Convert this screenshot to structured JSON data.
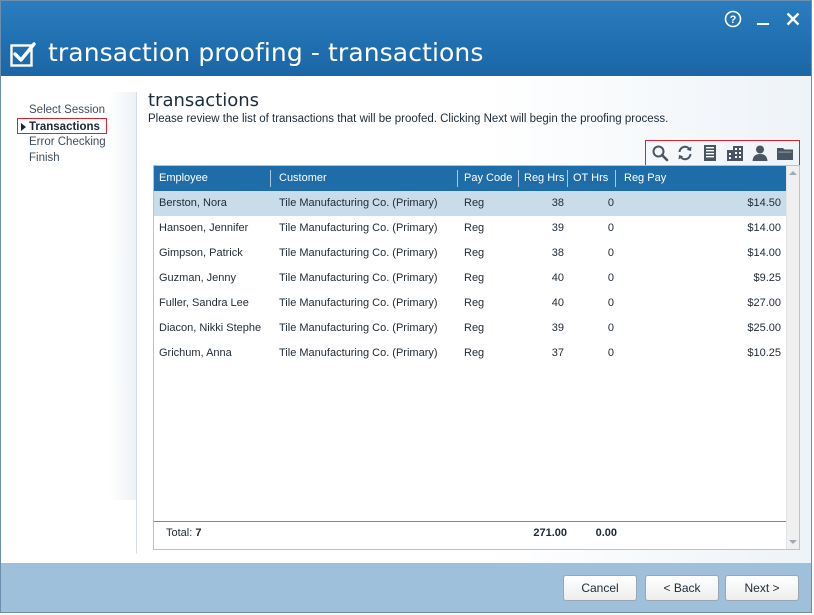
{
  "window": {
    "title": "transaction proofing - transactions",
    "help_glyph": "?",
    "minimize_glyph": "_",
    "close_glyph": "✕"
  },
  "nav": {
    "items": [
      {
        "label": "Select Session",
        "active": false
      },
      {
        "label": "Transactions",
        "active": true
      },
      {
        "label": "Error Checking",
        "active": false
      },
      {
        "label": "Finish",
        "active": false
      }
    ]
  },
  "main": {
    "title": "transactions",
    "description": "Please review the list of transactions that will be proofed.  Clicking Next will begin the proofing process."
  },
  "toolbar": {
    "icons": [
      "search-icon",
      "refresh-icon",
      "document-icon",
      "building-icon",
      "person-icon",
      "folder-icon"
    ]
  },
  "grid": {
    "columns": [
      "Employee",
      "Customer",
      "Pay Code",
      "Reg Hrs",
      "OT Hrs",
      "Reg Pay"
    ],
    "rows": [
      {
        "employee": "Berston, Nora",
        "customer": "Tile Manufacturing Co.  (Primary)",
        "pay_code": "Reg",
        "reg_hrs": "38",
        "ot_hrs": "0",
        "reg_pay": "$14.50"
      },
      {
        "employee": "Hansoen, Jennifer",
        "customer": "Tile Manufacturing Co.  (Primary)",
        "pay_code": "Reg",
        "reg_hrs": "39",
        "ot_hrs": "0",
        "reg_pay": "$14.00"
      },
      {
        "employee": "Gimpson, Patrick",
        "customer": "Tile Manufacturing Co.  (Primary)",
        "pay_code": "Reg",
        "reg_hrs": "38",
        "ot_hrs": "0",
        "reg_pay": "$14.00"
      },
      {
        "employee": "Guzman, Jenny",
        "customer": "Tile Manufacturing Co.  (Primary)",
        "pay_code": "Reg",
        "reg_hrs": "40",
        "ot_hrs": "0",
        "reg_pay": "$9.25"
      },
      {
        "employee": "Fuller, Sandra Lee",
        "customer": "Tile Manufacturing Co.  (Primary)",
        "pay_code": "Reg",
        "reg_hrs": "40",
        "ot_hrs": "0",
        "reg_pay": "$27.00"
      },
      {
        "employee": "Diacon, Nikki Stephe",
        "customer": "Tile Manufacturing Co.  (Primary)",
        "pay_code": "Reg",
        "reg_hrs": "39",
        "ot_hrs": "0",
        "reg_pay": "$25.00"
      },
      {
        "employee": "Grichum, Anna",
        "customer": "Tile Manufacturing Co.  (Primary)",
        "pay_code": "Reg",
        "reg_hrs": "37",
        "ot_hrs": "0",
        "reg_pay": "$10.25"
      }
    ],
    "footer": {
      "total_label": "Total:",
      "total_count": "7",
      "reg_hrs_total": "271.00",
      "ot_hrs_total": "0.00"
    }
  },
  "buttons": {
    "cancel": "Cancel",
    "back": "< Back",
    "next": "Next >"
  },
  "colors": {
    "title_bar": "#1f6fb0",
    "grid_header": "#1e6ca8",
    "selected_row": "#c9dcea",
    "bottom_bar": "#9fc0da",
    "highlight_border": "#d9242f"
  }
}
